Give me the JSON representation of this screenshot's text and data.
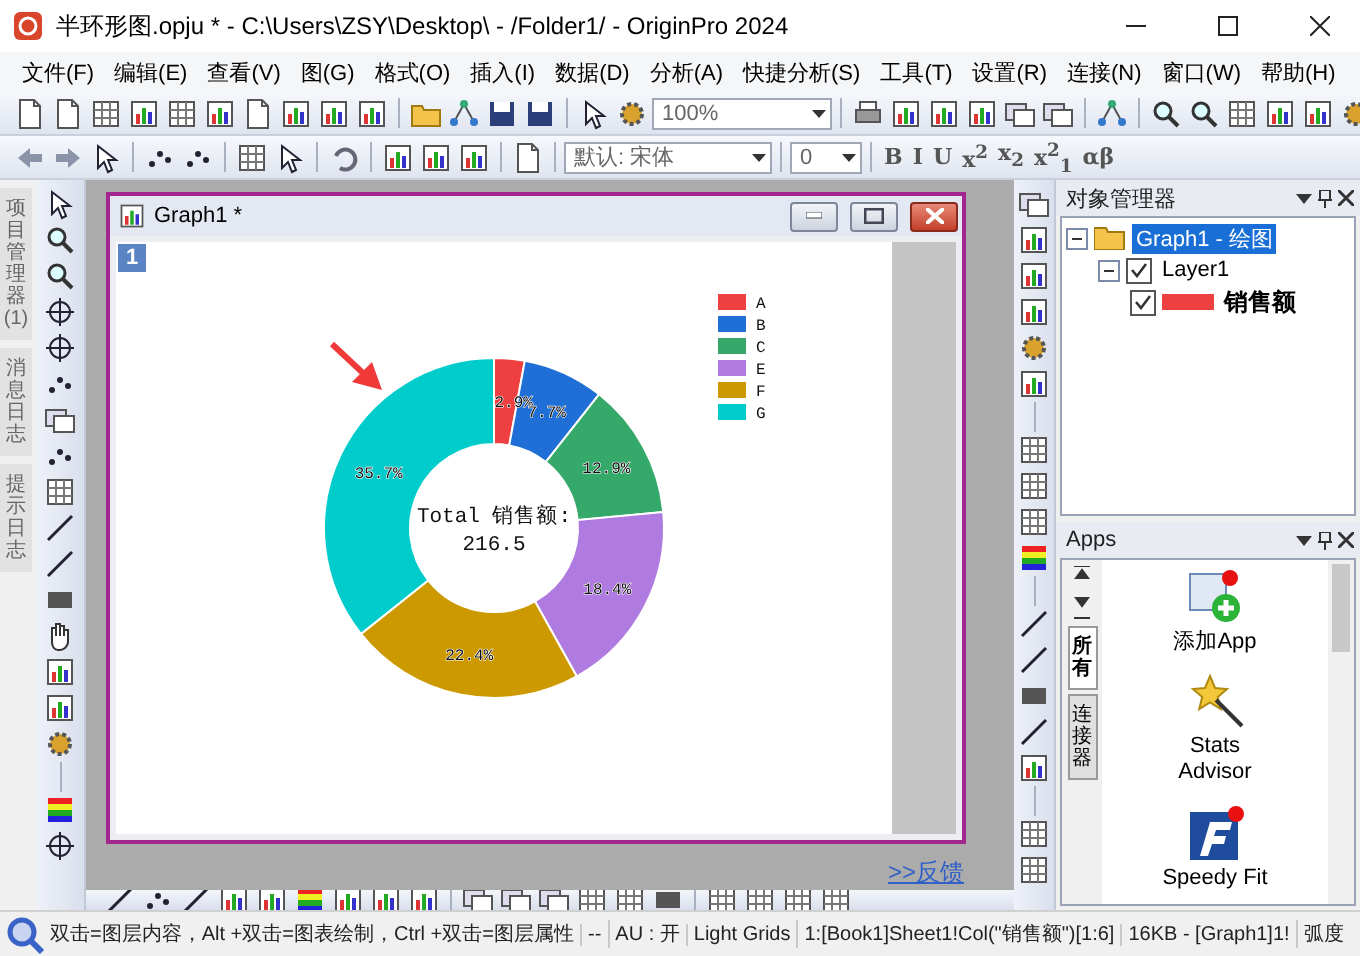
{
  "window": {
    "title": "半环形图.opju * - C:\\Users\\ZSY\\Desktop\\ - /Folder1/ - OriginPro 2024"
  },
  "menu": [
    "文件(F)",
    "编辑(E)",
    "查看(V)",
    "图(G)",
    "格式(O)",
    "插入(I)",
    "数据(D)",
    "分析(A)",
    "快捷分析(S)",
    "工具(T)",
    "设置(R)",
    "连接(N)",
    "窗口(W)",
    "帮助(H)"
  ],
  "toolbar": {
    "zoom": "100%",
    "font": "默认: 宋体",
    "font_size": "0",
    "format_buttons": [
      "B",
      "I",
      "U",
      "x$^{2}$",
      "x$_{2}$",
      "x$^{2}$$_{1}$",
      "αβ"
    ]
  },
  "side_tabs": [
    {
      "label": "项目管理器 (1)",
      "selected": false
    },
    {
      "label": "消息日志",
      "selected": false
    },
    {
      "label": "提示日志",
      "selected": false
    }
  ],
  "graph_window": {
    "title": "Graph1 *",
    "layer": "1",
    "center_text": [
      "Total 销售额:",
      "216.5"
    ],
    "chart_data": {
      "type": "donut",
      "categories": [
        "A",
        "B",
        "C",
        "E",
        "F",
        "G"
      ],
      "values": [
        2.9,
        7.7,
        12.9,
        18.4,
        22.4,
        35.7
      ],
      "value_labels": [
        "2.9%",
        "7.7%",
        "12.9%",
        "18.4%",
        "22.4%",
        "35.7%"
      ],
      "legend": "right"
    },
    "slices": [
      {
        "color": "#ee4040"
      },
      {
        "color": "#1f6fd6"
      },
      {
        "color": "#34a96a"
      },
      {
        "color": "#b07be0"
      },
      {
        "color": "#cc9900"
      },
      {
        "color": "#00cccc"
      }
    ]
  },
  "feedback_link": ">>反馈",
  "object_manager": {
    "title": "对象管理器",
    "tree": [
      {
        "label": "Graph1 - 绘图",
        "selected": true,
        "expanded": true,
        "children": [
          {
            "label": "Layer1",
            "selected": false,
            "checked": true,
            "expanded": true,
            "children": [
              {
                "label": "销售额",
                "selected": false,
                "checked": true,
                "color": "#ee4040"
              }
            ]
          }
        ]
      }
    ]
  },
  "apps": {
    "title": "Apps",
    "tabs": [
      {
        "label": "所有",
        "selected": true
      },
      {
        "label": "连接器",
        "selected": false
      }
    ],
    "items": [
      "添加App",
      "Stats Advisor",
      "Speedy Fit"
    ]
  },
  "status_bar": [
    "双击=图层内容，Alt +双击=图表绘制，Ctrl +双击=图层属性",
    "--",
    "AU : 开",
    "Light Grids",
    "1:[Book1]Sheet1!Col(\"销售额\")[1:6]",
    "16KB - [Graph1]1!",
    "弧度"
  ]
}
